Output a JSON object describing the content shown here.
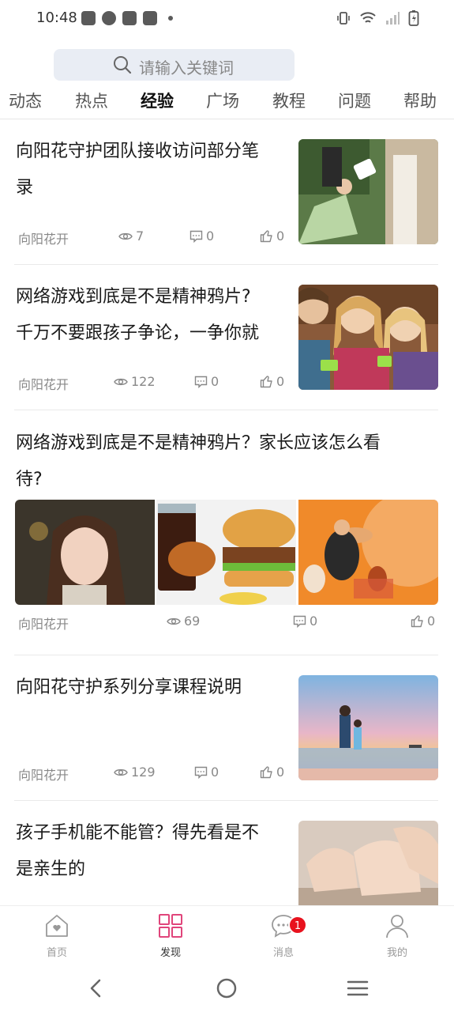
{
  "status_bar": {
    "time": "10:48"
  },
  "search": {
    "placeholder": "请输入关键词"
  },
  "tabs": [
    {
      "label": "动态"
    },
    {
      "label": "热点"
    },
    {
      "label": "经验",
      "active": true
    },
    {
      "label": "广场"
    },
    {
      "label": "教程"
    },
    {
      "label": "问题"
    },
    {
      "label": "帮助"
    }
  ],
  "articles": [
    {
      "title_line1": "向阳花守护团队接收访问部分笔",
      "title_line2": "录",
      "author": "向阳花开",
      "views": "7",
      "comments": "0",
      "likes": "0"
    },
    {
      "title_line1": "网络游戏到底是不是精神鸦片?",
      "title_line2": "千万不要跟孩子争论，一争你就",
      "author": "向阳花开",
      "views": "122",
      "comments": "0",
      "likes": "0"
    },
    {
      "title_line1": "网络游戏到底是不是精神鸦片？家长应该怎么看",
      "title_line2": "待?",
      "author": "向阳花开",
      "views": "69",
      "comments": "0",
      "likes": "0"
    },
    {
      "title_line1": "向阳花守护系列分享课程说明",
      "title_line2": "",
      "author": "向阳花开",
      "views": "129",
      "comments": "0",
      "likes": "0"
    },
    {
      "title_line1": "孩子手机能不能管？得先看是不",
      "title_line2": "是亲生的"
    }
  ],
  "bottom_nav": {
    "home": "首页",
    "discover": "发现",
    "messages": "消息",
    "messages_badge": "1",
    "mine": "我的"
  },
  "colors": {
    "accent": "#e0457b",
    "badge": "#e8121e"
  }
}
